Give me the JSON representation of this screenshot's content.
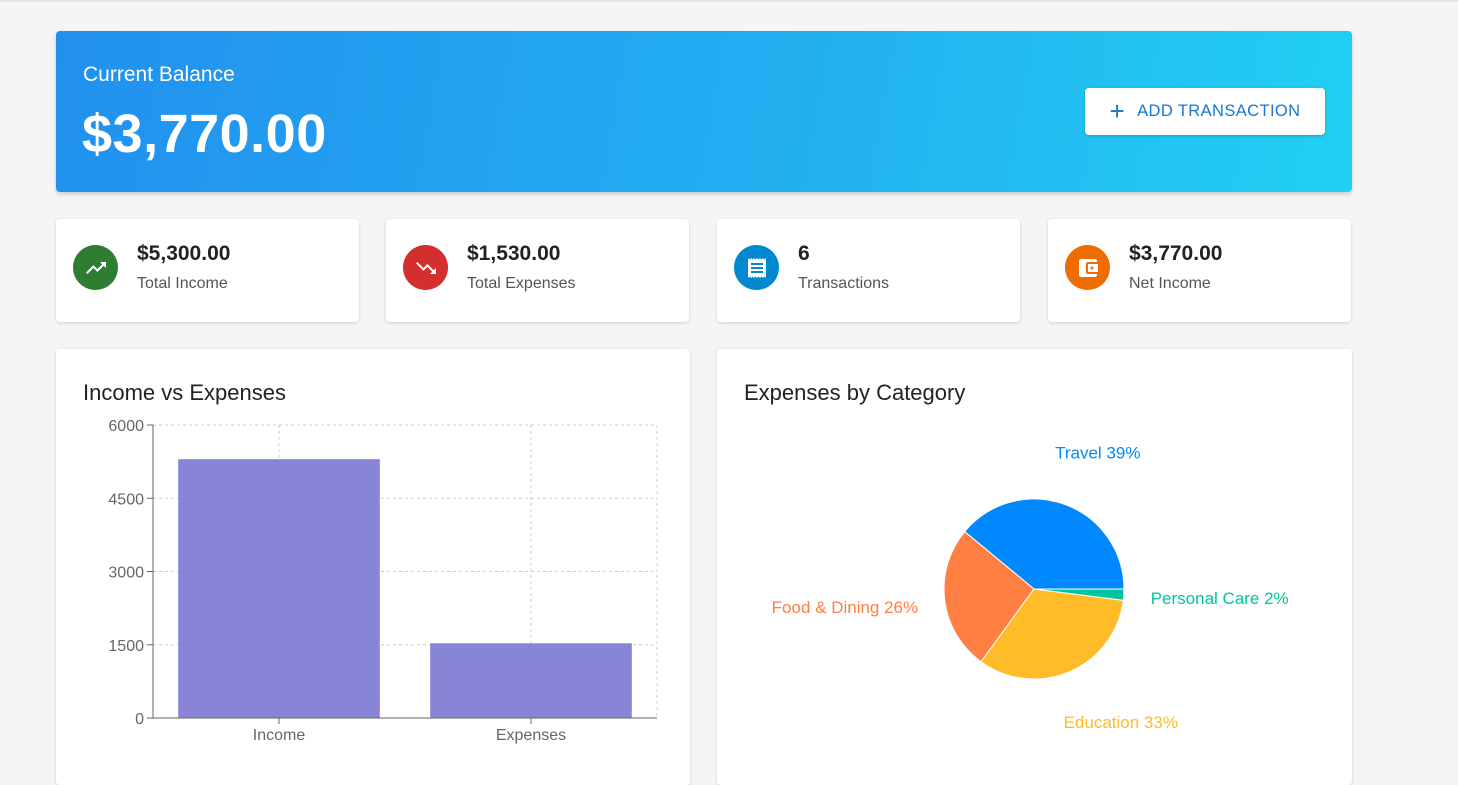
{
  "balance": {
    "label": "Current Balance",
    "amount": "$3,770.00",
    "add_button_label": "ADD TRANSACTION",
    "add_button_icon": "plus-icon"
  },
  "stats": [
    {
      "value": "$5,300.00",
      "label": "Total Income",
      "icon": "trending-up-icon",
      "color": "#2e7d32"
    },
    {
      "value": "$1,530.00",
      "label": "Total Expenses",
      "icon": "trending-down-icon",
      "color": "#d32f2f"
    },
    {
      "value": "6",
      "label": "Transactions",
      "icon": "receipt-icon",
      "color": "#0288d1"
    },
    {
      "value": "$3,770.00",
      "label": "Net Income",
      "icon": "wallet-icon",
      "color": "#ef6c00"
    }
  ],
  "bar_card": {
    "title": "Income vs Expenses"
  },
  "pie_card": {
    "title": "Expenses by Category"
  },
  "chart_data": [
    {
      "type": "bar",
      "title": "Income vs Expenses",
      "categories": [
        "Income",
        "Expenses"
      ],
      "values": [
        5300,
        1530
      ],
      "ylim": [
        0,
        6000
      ],
      "yticks": [
        0,
        1500,
        3000,
        4500,
        6000
      ],
      "grid": true,
      "bar_color": "#8884d8"
    },
    {
      "type": "pie",
      "title": "Expenses by Category",
      "slices": [
        {
          "label": "Travel",
          "percent_label": "Travel 39%",
          "value": 39,
          "color": "#0088fe"
        },
        {
          "label": "Food & Dining",
          "percent_label": "Food & Dining 26%",
          "value": 26,
          "color": "#ff8042"
        },
        {
          "label": "Education",
          "percent_label": "Education 33%",
          "value": 33,
          "color": "#ffbb28"
        },
        {
          "label": "Personal Care",
          "percent_label": "Personal Care 2%",
          "value": 2,
          "color": "#00c49f"
        }
      ]
    }
  ]
}
